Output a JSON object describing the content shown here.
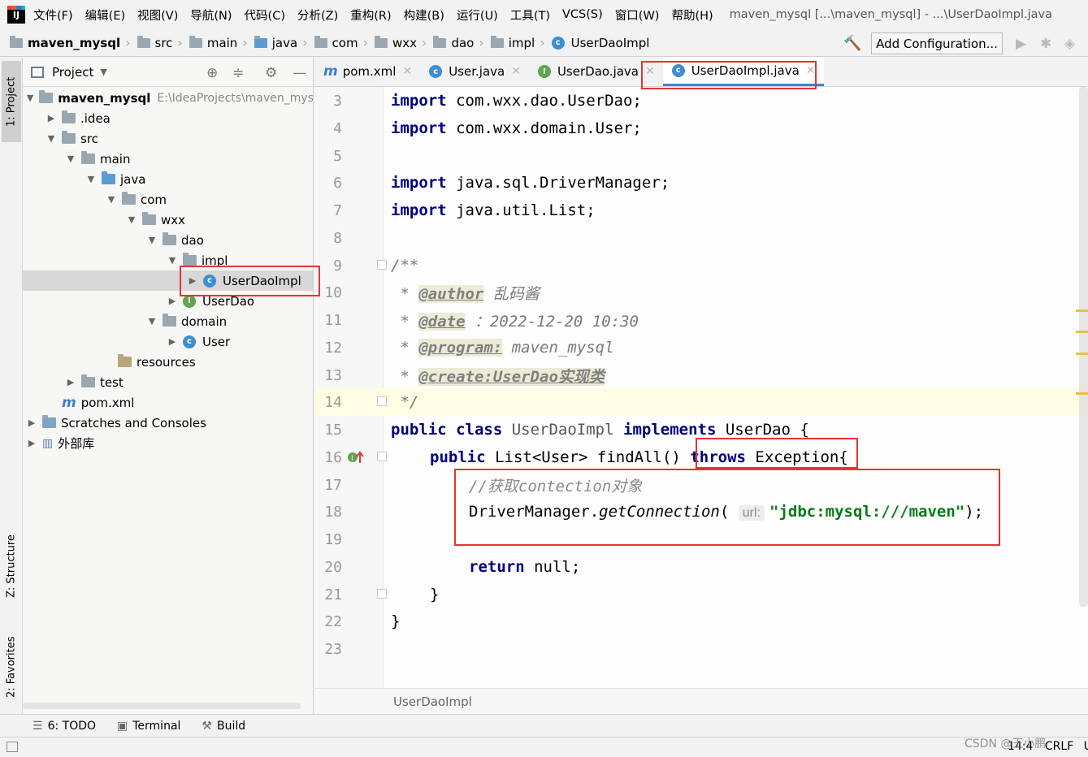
{
  "app": {
    "logo_text": "IJ",
    "window_title": "maven_mysql [...\\maven_mysql] - ...\\UserDaoImpl.java",
    "menu": [
      "文件(F)",
      "编辑(E)",
      "视图(V)",
      "导航(N)",
      "代码(C)",
      "分析(Z)",
      "重构(R)",
      "构建(B)",
      "运行(U)",
      "工具(T)",
      "VCS(S)",
      "窗口(W)",
      "帮助(H)"
    ]
  },
  "navbar": {
    "breadcrumbs": [
      "maven_mysql",
      "src",
      "main",
      "java",
      "com",
      "wxx",
      "dao",
      "impl",
      "UserDaoImpl"
    ],
    "add_configuration": "Add Configuration..."
  },
  "tool_strip": {
    "project_tab": "1: Project",
    "structure_tab": "Z: Structure",
    "favorites_tab": "2: Favorites"
  },
  "project_panel": {
    "title": "Project",
    "tree": [
      {
        "label": "maven_mysql",
        "path": "E:\\IdeaProjects\\maven_mys",
        "bold": true
      },
      {
        "label": ".idea"
      },
      {
        "label": "src"
      },
      {
        "label": "main"
      },
      {
        "label": "java"
      },
      {
        "label": "com"
      },
      {
        "label": "wxx"
      },
      {
        "label": "dao"
      },
      {
        "label": "impl"
      },
      {
        "label": "UserDaoImpl",
        "icon_letter": "c"
      },
      {
        "label": "UserDao",
        "icon_letter": "I"
      },
      {
        "label": "domain"
      },
      {
        "label": "User",
        "icon_letter": "c"
      },
      {
        "label": "resources"
      },
      {
        "label": "test"
      },
      {
        "label": "pom.xml",
        "icon_letter": "m"
      },
      {
        "label": "Scratches and Consoles"
      },
      {
        "label": "外部库"
      }
    ]
  },
  "tabs": [
    {
      "label": "pom.xml",
      "icon": "m"
    },
    {
      "label": "User.java",
      "icon": "c"
    },
    {
      "label": "UserDao.java",
      "icon": "I"
    },
    {
      "label": "UserDaoImpl.java",
      "icon": "c",
      "active": true
    }
  ],
  "editor": {
    "line_numbers": [
      "3",
      "4",
      "5",
      "6",
      "7",
      "8",
      "9",
      "10",
      "11",
      "12",
      "13",
      "14",
      "15",
      "16",
      "17",
      "18",
      "19",
      "20",
      "21",
      "22",
      "23"
    ],
    "code": {
      "l3": {
        "kw": "import",
        "rest": " com.wxx.dao.UserDao;"
      },
      "l4": {
        "kw": "import",
        "rest": " com.wxx.domain.User;"
      },
      "l6": {
        "kw": "import",
        "rest": " java.sql.DriverManager;"
      },
      "l7": {
        "kw": "import",
        "rest": " java.util.List;"
      },
      "l9": "/**",
      "l10": {
        "prefix": " * ",
        "tag": "@author",
        "text": " 乱码酱"
      },
      "l11": {
        "prefix": " * ",
        "tag": "@date",
        "text": " ：2022-12-20 10:30"
      },
      "l12": {
        "prefix": " * ",
        "tag": "@program:",
        "text": " maven_mysql"
      },
      "l13": {
        "prefix": " * ",
        "tag": "@create:UserDao实现类"
      },
      "l14": " */",
      "l15": {
        "kw1": "public",
        "kw2": "class",
        "name": " UserDaoImpl ",
        "kw3": "implements",
        "rest": " UserDao {"
      },
      "l16": {
        "kw1": "public",
        "type": " List<User> findAll() ",
        "kw2": "throws",
        "rest": " Exception{"
      },
      "l17": "//获取contection对象",
      "l18": {
        "obj": "DriverManager.",
        "method": "getConnection",
        "open": "(",
        "hint": "url:",
        "string": "\"jdbc:mysql:///maven\"",
        "close": ");"
      },
      "l20": {
        "kw": "return",
        "rest": " null;"
      },
      "l21": "}",
      "l22": "}"
    },
    "breadcrumb": "UserDaoImpl"
  },
  "bottom_tools": [
    {
      "label": "6: TODO",
      "icon": "list-icon"
    },
    {
      "label": "Terminal",
      "icon": "terminal-icon"
    },
    {
      "label": "Build",
      "icon": "hammer-icon"
    }
  ],
  "status": {
    "position": "14:4",
    "line_sep": "CRLF",
    "encoding_short": "U"
  },
  "watermark": "CSDN @王小鹏",
  "colors": {
    "keyword": "#000080",
    "string": "#067d17",
    "accent": "#4083c9",
    "annotation_box": "#e53333"
  }
}
